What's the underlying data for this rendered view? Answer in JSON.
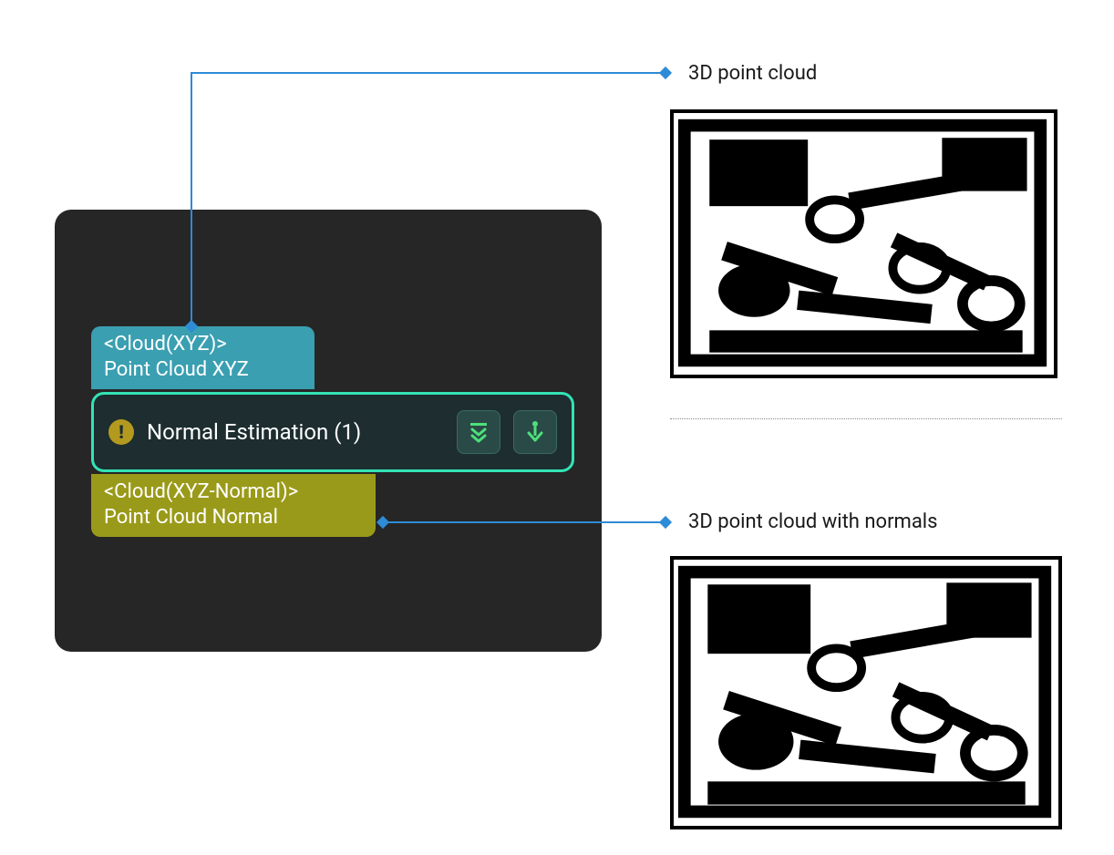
{
  "node": {
    "input_port_type": "<Cloud(XYZ)>",
    "input_port_label": "Point Cloud XYZ",
    "title": "Normal Estimation (1)",
    "output_port_type": "<Cloud(XYZ-Normal)>",
    "output_port_label": "Point Cloud Normal",
    "icons": {
      "warning": "warning-icon",
      "expand": "expand-down-icon",
      "download": "download-icon"
    }
  },
  "labels": {
    "input": "3D point cloud",
    "output": "3D point cloud with normals"
  },
  "colors": {
    "panel_bg": "#262626",
    "input_port": "#3a9fb1",
    "output_port": "#9a9a1a",
    "node_border": "#34e3b4",
    "node_bg": "#1d2d30",
    "connector": "#2e8bd6",
    "icon_btn": "#2a4a47",
    "icon_arrow": "#4de07a"
  }
}
